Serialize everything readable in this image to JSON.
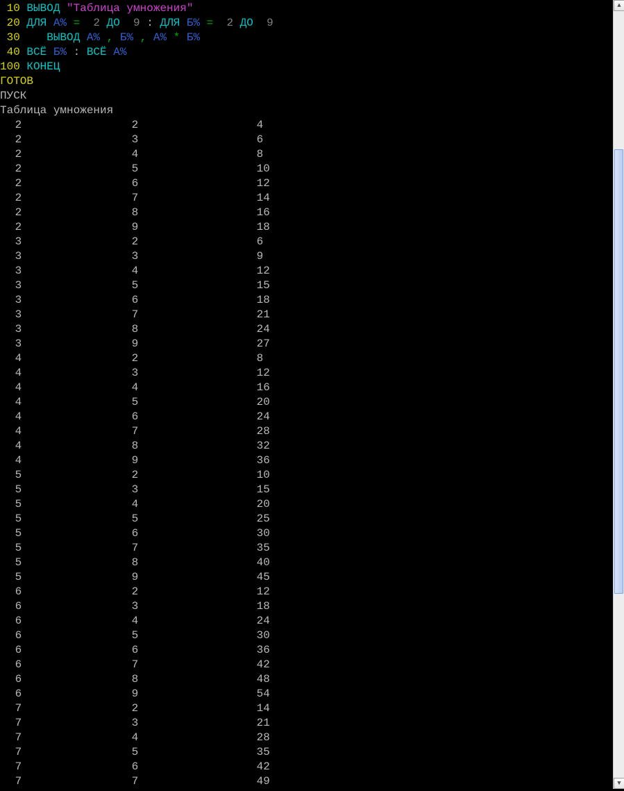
{
  "code": {
    "lines": [
      {
        "num": "10",
        "t": [
          {
            "c": "kw",
            "v": "ВЫВОД "
          },
          {
            "c": "str",
            "v": "\"Таблица умножения\""
          }
        ]
      },
      {
        "num": "20",
        "t": [
          {
            "c": "kw",
            "v": "ДЛЯ "
          },
          {
            "c": "ident",
            "v": "А%"
          },
          {
            "c": "op",
            "v": " =  "
          },
          {
            "c": "num",
            "v": "2"
          },
          {
            "c": "kw",
            "v": " ДО  "
          },
          {
            "c": "num",
            "v": "9"
          },
          {
            "c": "plain",
            "v": " : "
          },
          {
            "c": "kw",
            "v": "ДЛЯ "
          },
          {
            "c": "ident",
            "v": "Б%"
          },
          {
            "c": "op",
            "v": " =  "
          },
          {
            "c": "num",
            "v": "2"
          },
          {
            "c": "kw",
            "v": " ДО  "
          },
          {
            "c": "num",
            "v": "9"
          }
        ]
      },
      {
        "num": "30",
        "t": [
          {
            "c": "plain",
            "v": "   "
          },
          {
            "c": "kw",
            "v": "ВЫВОД "
          },
          {
            "c": "ident",
            "v": "А%"
          },
          {
            "c": "op",
            "v": " , "
          },
          {
            "c": "ident",
            "v": "Б%"
          },
          {
            "c": "op",
            "v": " , "
          },
          {
            "c": "ident",
            "v": "А%"
          },
          {
            "c": "op",
            "v": " * "
          },
          {
            "c": "ident",
            "v": "Б%"
          }
        ]
      },
      {
        "num": "40",
        "t": [
          {
            "c": "kw",
            "v": "ВСЁ "
          },
          {
            "c": "ident",
            "v": "Б%"
          },
          {
            "c": "plain",
            "v": " : "
          },
          {
            "c": "kw",
            "v": "ВСЁ "
          },
          {
            "c": "ident",
            "v": "А%"
          }
        ]
      },
      {
        "num": "100",
        "t": [
          {
            "c": "kw",
            "v": "КОНЕЦ"
          }
        ]
      }
    ]
  },
  "status": {
    "ready": "ГОТОВ",
    "run": "ПУСК",
    "title": "Таблица умножения"
  },
  "table": {
    "rows": [
      {
        "a": "2",
        "b": "2",
        "p": "4"
      },
      {
        "a": "2",
        "b": "3",
        "p": "6"
      },
      {
        "a": "2",
        "b": "4",
        "p": "8"
      },
      {
        "a": "2",
        "b": "5",
        "p": "10"
      },
      {
        "a": "2",
        "b": "6",
        "p": "12"
      },
      {
        "a": "2",
        "b": "7",
        "p": "14"
      },
      {
        "a": "2",
        "b": "8",
        "p": "16"
      },
      {
        "a": "2",
        "b": "9",
        "p": "18"
      },
      {
        "a": "3",
        "b": "2",
        "p": "6"
      },
      {
        "a": "3",
        "b": "3",
        "p": "9"
      },
      {
        "a": "3",
        "b": "4",
        "p": "12"
      },
      {
        "a": "3",
        "b": "5",
        "p": "15"
      },
      {
        "a": "3",
        "b": "6",
        "p": "18"
      },
      {
        "a": "3",
        "b": "7",
        "p": "21"
      },
      {
        "a": "3",
        "b": "8",
        "p": "24"
      },
      {
        "a": "3",
        "b": "9",
        "p": "27"
      },
      {
        "a": "4",
        "b": "2",
        "p": "8"
      },
      {
        "a": "4",
        "b": "3",
        "p": "12"
      },
      {
        "a": "4",
        "b": "4",
        "p": "16"
      },
      {
        "a": "4",
        "b": "5",
        "p": "20"
      },
      {
        "a": "4",
        "b": "6",
        "p": "24"
      },
      {
        "a": "4",
        "b": "7",
        "p": "28"
      },
      {
        "a": "4",
        "b": "8",
        "p": "32"
      },
      {
        "a": "4",
        "b": "9",
        "p": "36"
      },
      {
        "a": "5",
        "b": "2",
        "p": "10"
      },
      {
        "a": "5",
        "b": "3",
        "p": "15"
      },
      {
        "a": "5",
        "b": "4",
        "p": "20"
      },
      {
        "a": "5",
        "b": "5",
        "p": "25"
      },
      {
        "a": "5",
        "b": "6",
        "p": "30"
      },
      {
        "a": "5",
        "b": "7",
        "p": "35"
      },
      {
        "a": "5",
        "b": "8",
        "p": "40"
      },
      {
        "a": "5",
        "b": "9",
        "p": "45"
      },
      {
        "a": "6",
        "b": "2",
        "p": "12"
      },
      {
        "a": "6",
        "b": "3",
        "p": "18"
      },
      {
        "a": "6",
        "b": "4",
        "p": "24"
      },
      {
        "a": "6",
        "b": "5",
        "p": "30"
      },
      {
        "a": "6",
        "b": "6",
        "p": "36"
      },
      {
        "a": "6",
        "b": "7",
        "p": "42"
      },
      {
        "a": "6",
        "b": "8",
        "p": "48"
      },
      {
        "a": "6",
        "b": "9",
        "p": "54"
      },
      {
        "a": "7",
        "b": "2",
        "p": "14"
      },
      {
        "a": "7",
        "b": "3",
        "p": "21"
      },
      {
        "a": "7",
        "b": "4",
        "p": "28"
      },
      {
        "a": "7",
        "b": "5",
        "p": "35"
      },
      {
        "a": "7",
        "b": "6",
        "p": "42"
      },
      {
        "a": "7",
        "b": "7",
        "p": "49"
      }
    ]
  },
  "scrollbar": {
    "up_glyph": "▲",
    "down_glyph": "▼"
  }
}
